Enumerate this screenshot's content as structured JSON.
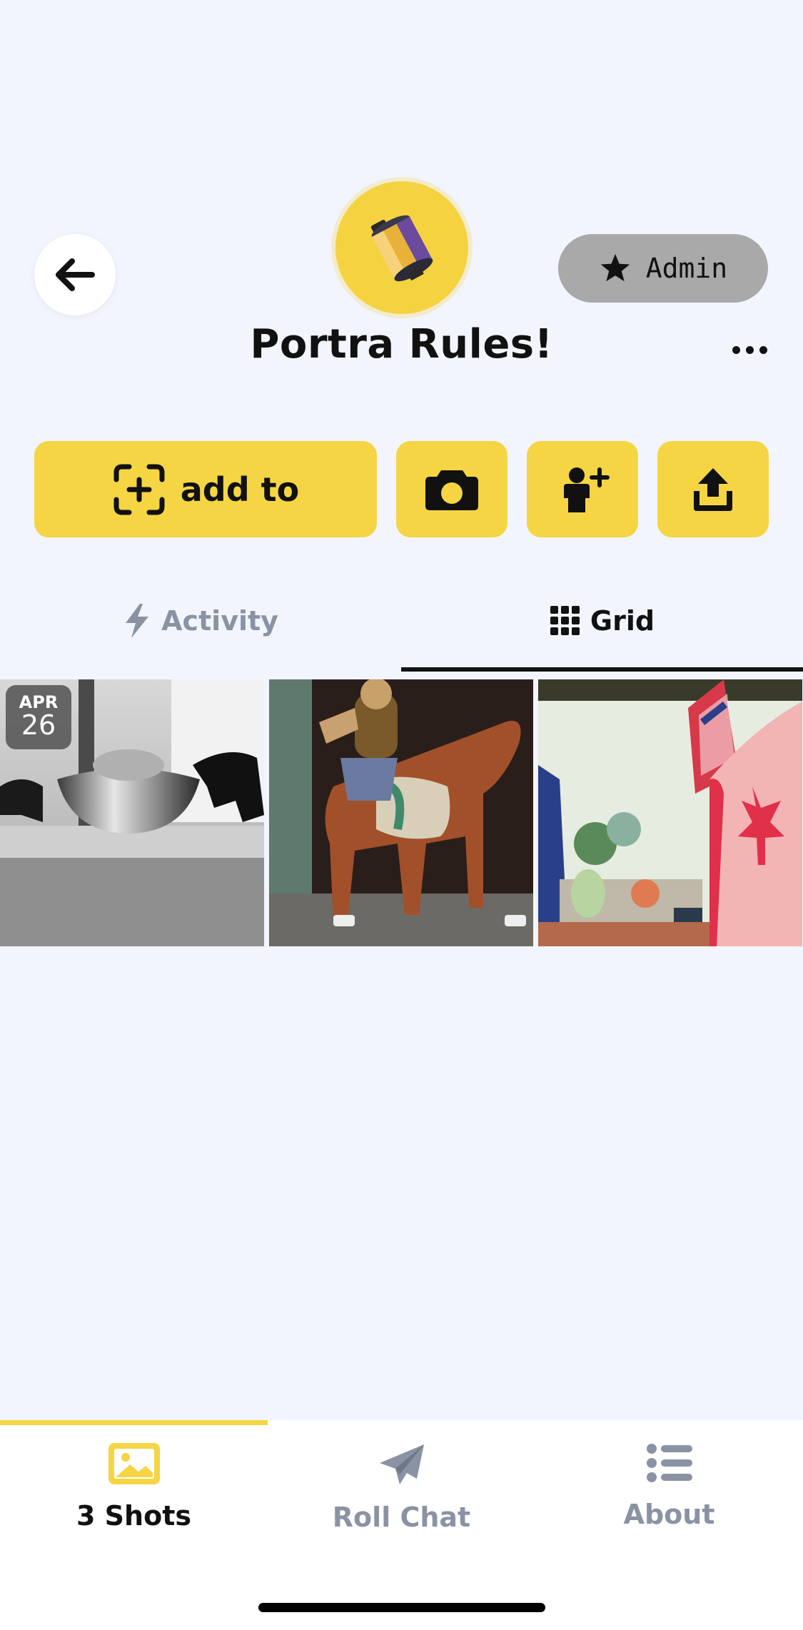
{
  "header": {
    "back_icon": "arrow-left-icon",
    "avatar_icon": "film-canister-icon",
    "admin_label": "Admin",
    "admin_icon": "star-icon",
    "title": "Portra Rules!",
    "more_icon": "ellipsis-icon"
  },
  "actions": {
    "add_label": "add to",
    "add_icon": "add-frame-icon",
    "camera_icon": "camera-icon",
    "invite_icon": "add-person-icon",
    "share_icon": "share-upload-icon"
  },
  "tabs": [
    {
      "label": "Activity",
      "icon": "lightning-icon",
      "active": false
    },
    {
      "label": "Grid",
      "icon": "grid-icon",
      "active": true
    }
  ],
  "grid": {
    "date_badge": {
      "month": "APR",
      "day": "26"
    },
    "photos": [
      {
        "description_name": "photo-silver-ingot"
      },
      {
        "description_name": "photo-horse-rider-figurine"
      },
      {
        "description_name": "photo-flags-shelf"
      }
    ]
  },
  "bottom_nav": [
    {
      "label": "3 Shots",
      "icon": "photo-icon",
      "active": true
    },
    {
      "label": "Roll Chat",
      "icon": "paper-plane-icon",
      "active": false
    },
    {
      "label": "About",
      "icon": "list-icon",
      "active": false
    }
  ],
  "colors": {
    "background": "#f2f5fd",
    "accent_yellow": "#f5d544",
    "muted_text": "#8a93a4",
    "admin_pill": "#a9a9a9"
  }
}
